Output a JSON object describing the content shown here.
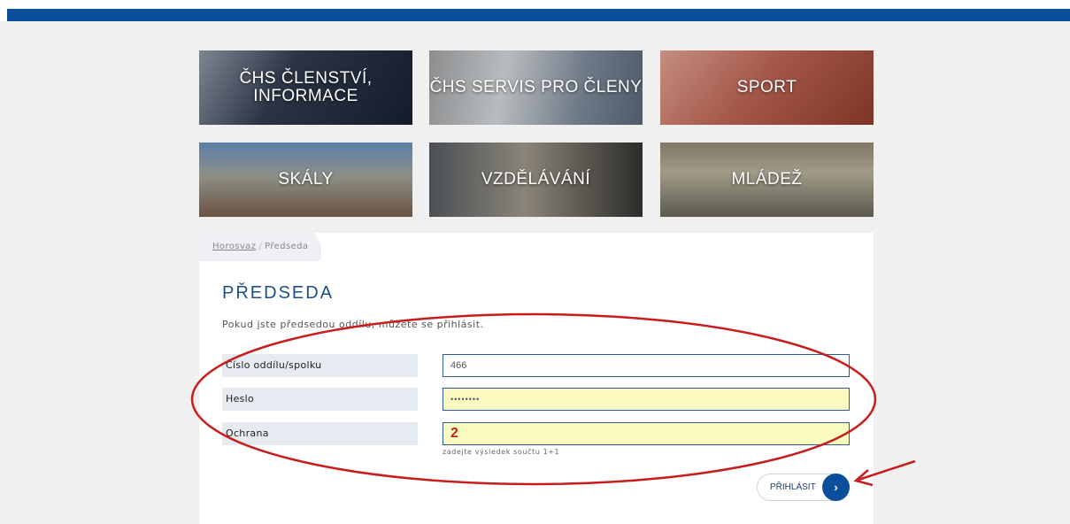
{
  "tiles": [
    {
      "label": "ČHS ČLENSTVÍ, INFORMACE"
    },
    {
      "label": "ČHS SERVIS PRO ČLENY"
    },
    {
      "label": "SPORT"
    },
    {
      "label": "SKÁLY"
    },
    {
      "label": "VZDĚLÁVÁNÍ"
    },
    {
      "label": "MLÁDEŽ"
    }
  ],
  "breadcrumb": {
    "home": "Horosvaz",
    "separator": "/",
    "current": "Předseda"
  },
  "page": {
    "title": "PŘEDSEDA",
    "intro": "Pokud jste předsedou oddílu, můžete se přihlásit."
  },
  "form": {
    "club_number": {
      "label": "Číslo oddílu/spolku",
      "value": "466"
    },
    "password": {
      "label": "Heslo",
      "value": "••••••••"
    },
    "captcha": {
      "label": "Ochrana",
      "value": "2",
      "hint": "zadejte výsledek součtu 1+1"
    },
    "submit_label": "PŘIHLÁSIT"
  },
  "colors": {
    "brand": "#0b4f9c",
    "title": "#1d4f8a",
    "field_highlight": "#fbfcc2",
    "annotation": "#c81d1d"
  }
}
